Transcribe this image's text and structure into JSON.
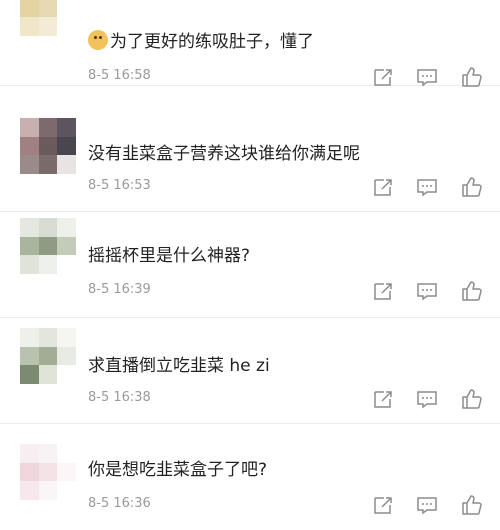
{
  "comments": [
    {
      "text": "为了更好的练吸肚子，懂了",
      "time": "8-5 16:58",
      "has_emoji": true
    },
    {
      "text": "没有韭菜盒子营养这块谁给你满足呢",
      "time": "8-5 16:53"
    },
    {
      "text": "摇摇杯里是什么神器?",
      "time": "8-5 16:39"
    },
    {
      "text": "求直播倒立吃韭菜 he zi",
      "time": "8-5 16:38"
    },
    {
      "text": "你是想吃韭菜盒子了吧?",
      "time": "8-5 16:36"
    }
  ],
  "icons": {
    "share": "share-icon",
    "comment": "comment-icon",
    "like": "like-icon"
  },
  "colors": {
    "text": "#222222",
    "meta": "#9a9a9a",
    "icon": "#8c8c8c"
  }
}
